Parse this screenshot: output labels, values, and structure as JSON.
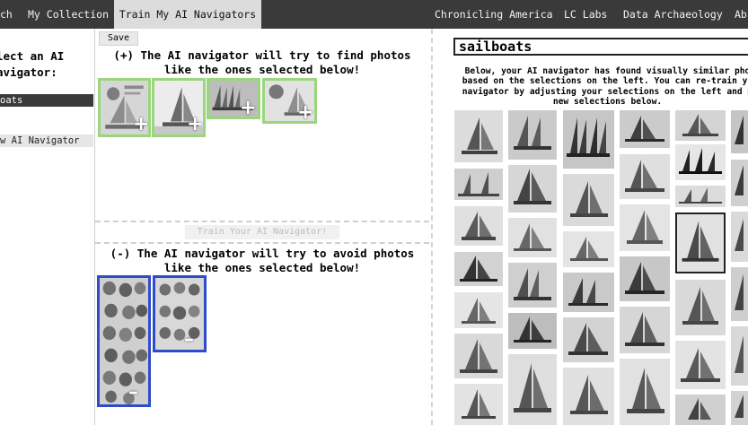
{
  "nav": {
    "items": [
      {
        "name": "nav-search",
        "label": "ch"
      },
      {
        "name": "nav-my-collection",
        "label": "My Collection"
      },
      {
        "name": "nav-train",
        "label": "Train My AI Navigators"
      },
      {
        "name": "nav-chronicling-america",
        "label": "Chronicling America"
      },
      {
        "name": "nav-lc-labs",
        "label": "LC Labs"
      },
      {
        "name": "nav-data-archaeology",
        "label": "Data Archaeology"
      },
      {
        "name": "nav-about",
        "label": "Ab"
      }
    ]
  },
  "sidebar": {
    "heading": "lect an AI\navigator:",
    "selected_navigator": "oats",
    "new_navigator": "w AI Navigator"
  },
  "middle": {
    "save_label": "Save",
    "positive_title": "(+) The AI navigator will try to find photos\nlike the ones selected below!",
    "train_label": "Train Your AI Navigator!",
    "negative_title": "(-) The AI navigator will try to avoid photos\nlike the ones selected below!",
    "add_glyph": "+",
    "remove_glyph": "–"
  },
  "results": {
    "query": "sailboats",
    "description": "Below, your AI navigator has found visually similar pho\nbased on the selections on the left. You can re-train yo\nnavigator by adjusting your selections on the left and m\nnew selections below."
  },
  "colors": {
    "positive_border": "#9bd67e",
    "negative_border": "#2e4bc9",
    "nav_bg": "#3a3a3a"
  }
}
